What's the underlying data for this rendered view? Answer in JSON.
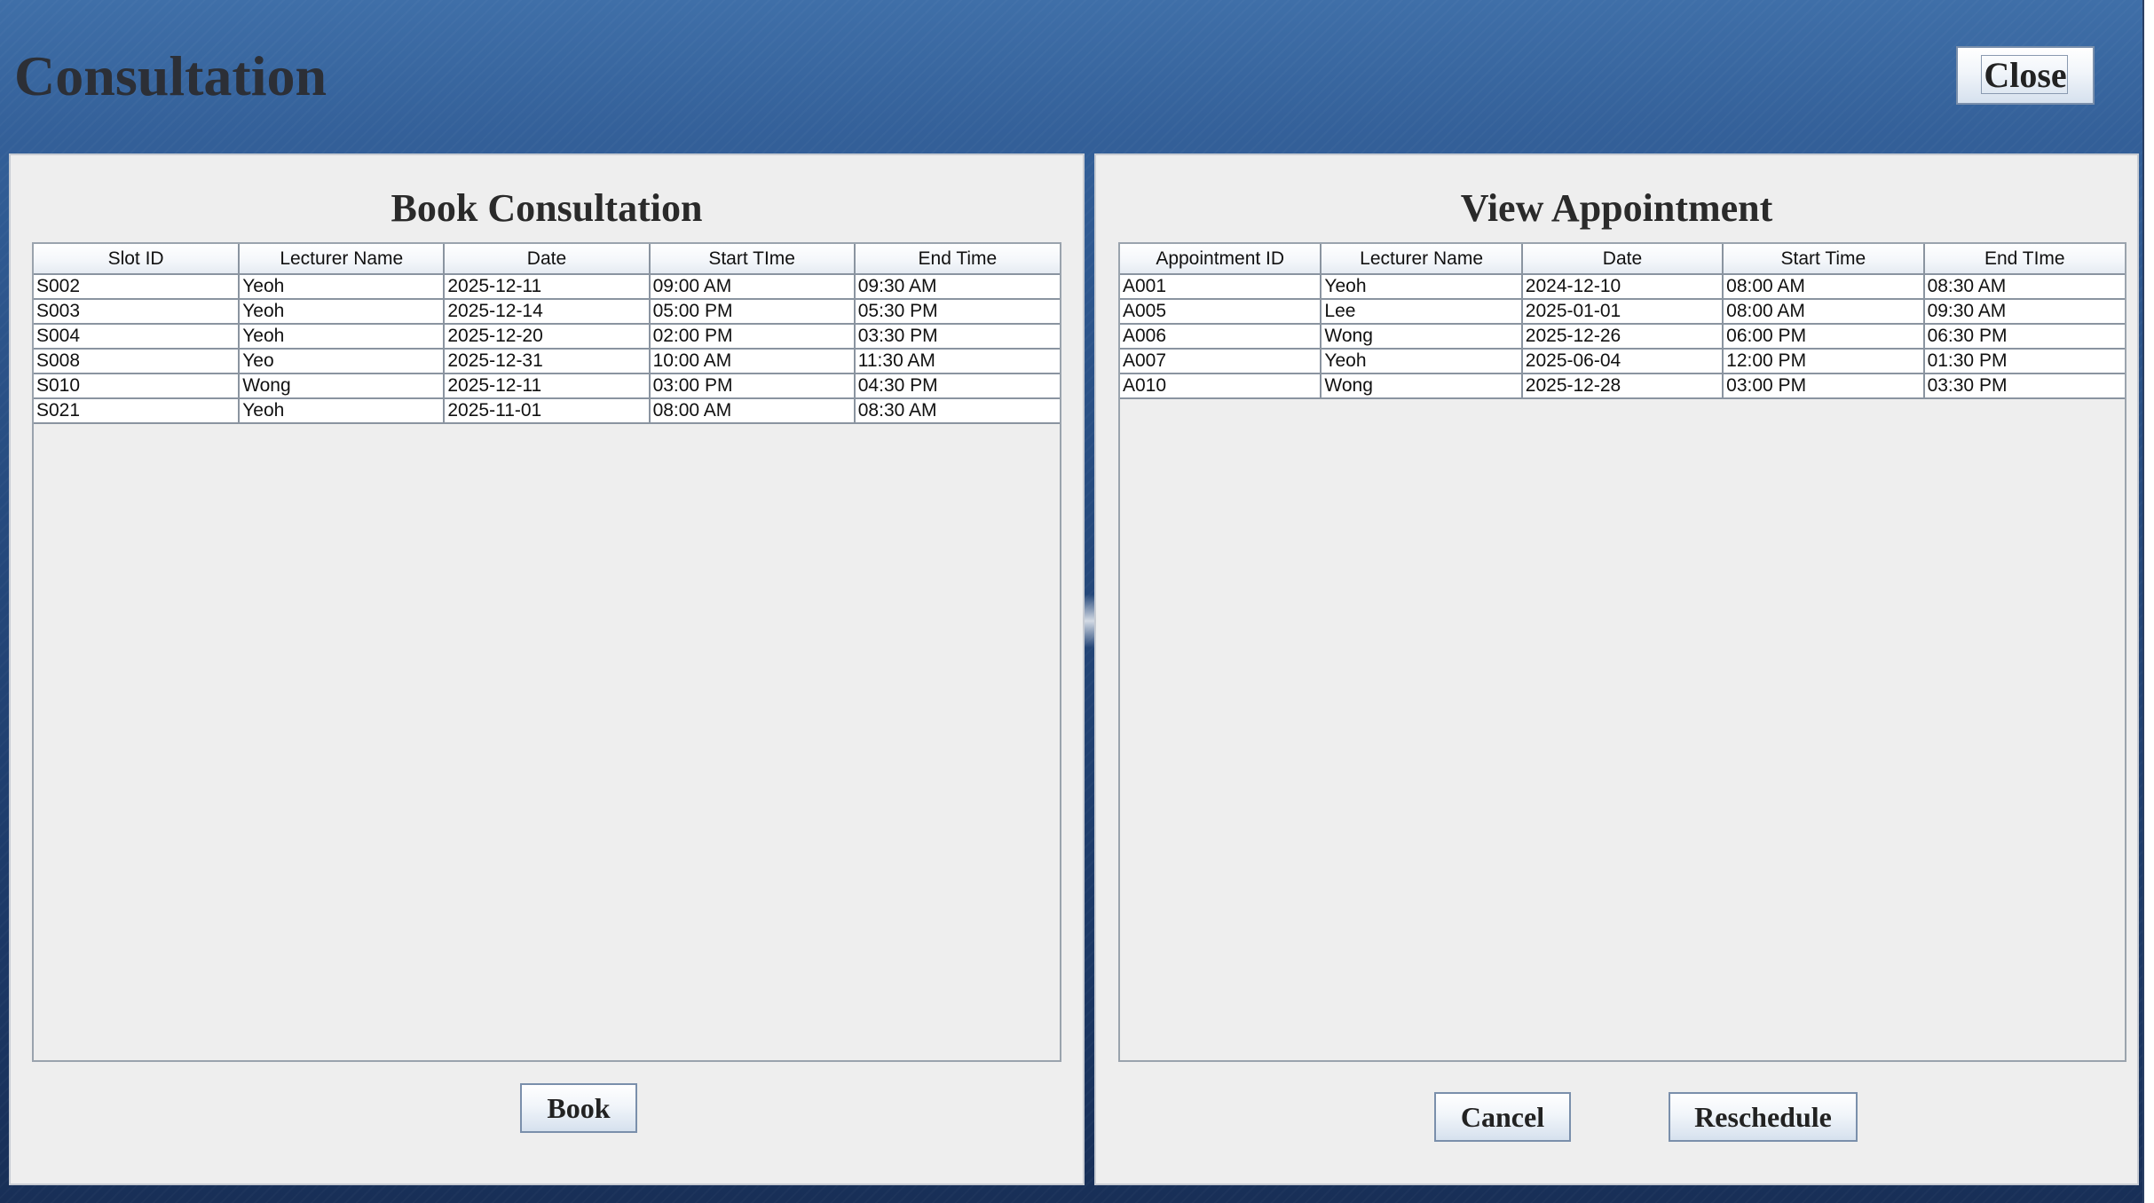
{
  "header": {
    "title": "Consultation",
    "close_label": "Close"
  },
  "book_panel": {
    "title": "Book Consultation",
    "columns": [
      "Slot ID",
      "Lecturer Name",
      "Date",
      "Start TIme",
      "End Time"
    ],
    "rows": [
      [
        "S002",
        "Yeoh",
        "2025-12-11",
        "09:00 AM",
        "09:30 AM"
      ],
      [
        "S003",
        "Yeoh",
        "2025-12-14",
        "05:00 PM",
        "05:30 PM"
      ],
      [
        "S004",
        "Yeoh",
        "2025-12-20",
        "02:00 PM",
        "03:30 PM"
      ],
      [
        "S008",
        "Yeo",
        "2025-12-31",
        "10:00 AM",
        "11:30 AM"
      ],
      [
        "S010",
        "Wong",
        "2025-12-11",
        "03:00 PM",
        "04:30 PM"
      ],
      [
        "S021",
        "Yeoh",
        "2025-11-01",
        "08:00 AM",
        "08:30 AM"
      ]
    ],
    "book_label": "Book"
  },
  "appointment_panel": {
    "title": "View Appointment",
    "columns": [
      "Appointment ID",
      "Lecturer Name",
      "Date",
      "Start Time",
      "End TIme"
    ],
    "rows": [
      [
        "A001",
        "Yeoh",
        "2024-12-10",
        "08:00 AM",
        "08:30 AM"
      ],
      [
        "A005",
        "Lee",
        "2025-01-01",
        "08:00 AM",
        "09:30 AM"
      ],
      [
        "A006",
        "Wong",
        "2025-12-26",
        "06:00 PM",
        "06:30 PM"
      ],
      [
        "A007",
        "Yeoh",
        "2025-06-04",
        "12:00 PM",
        "01:30 PM"
      ],
      [
        "A010",
        "Wong",
        "2025-12-28",
        "03:00 PM",
        "03:30 PM"
      ]
    ],
    "cancel_label": "Cancel",
    "reschedule_label": "Reschedule"
  }
}
